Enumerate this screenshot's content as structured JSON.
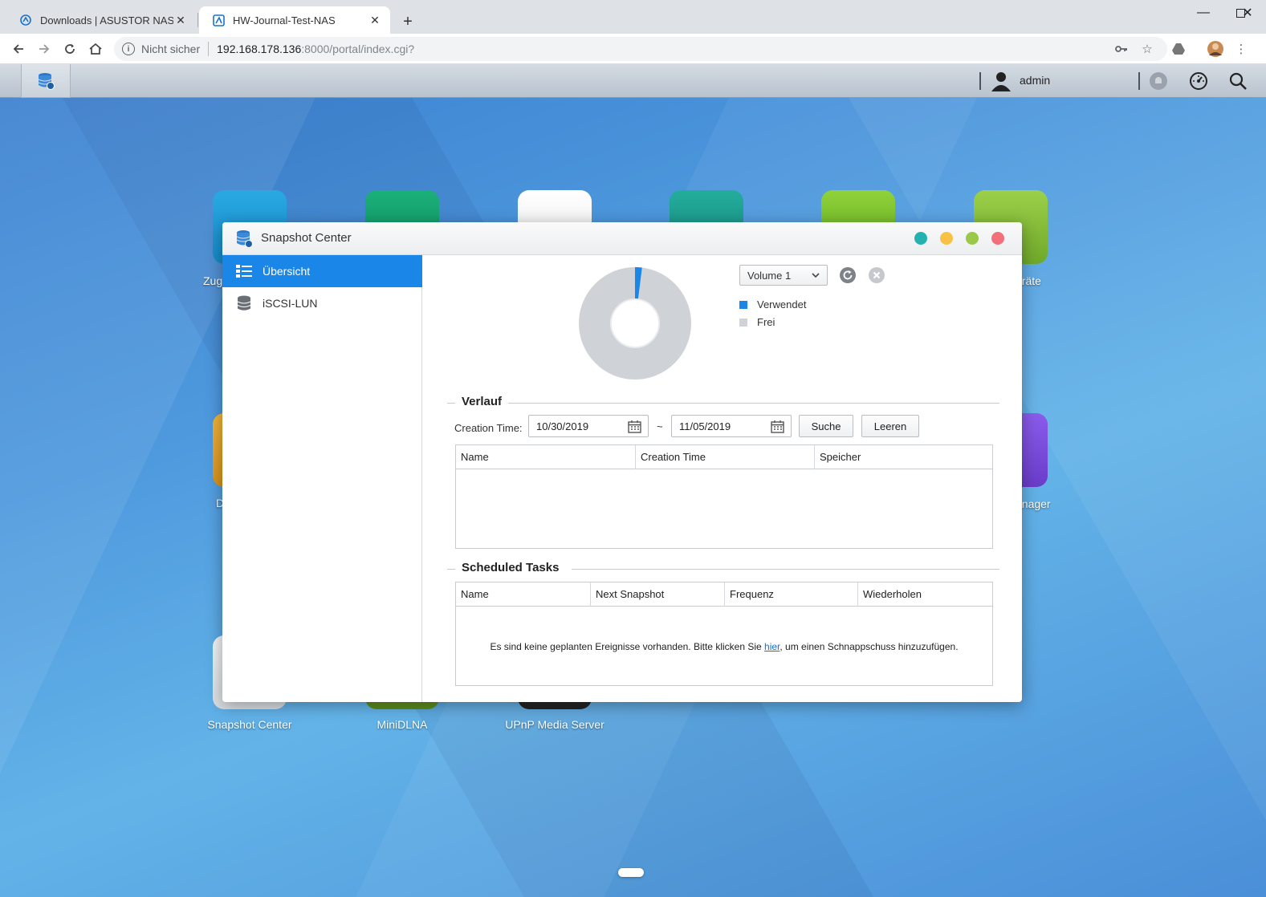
{
  "browser": {
    "tabs": [
      {
        "title": "Downloads | ASUSTOR NAS",
        "active": false
      },
      {
        "title": "HW-Journal-Test-NAS",
        "active": true
      }
    ],
    "security_label": "Nicht sicher",
    "url_host": "192.168.178.136",
    "url_path": ":8000/portal/index.cgi?"
  },
  "taskbar": {
    "user": "admin"
  },
  "desktop_icons": [
    {
      "label": "Zug",
      "color": "#1b9ad6"
    },
    {
      "label": "",
      "color": "#16a06f"
    },
    {
      "label": "",
      "color": "#f3f3f3"
    },
    {
      "label": "",
      "color": "#1a9a8a"
    },
    {
      "label": "",
      "color": "#7cc62e"
    },
    {
      "label": "eräte",
      "color": "#8cc63e"
    },
    {
      "label": "D",
      "color": "#e8a42a"
    },
    {
      "label": "anager",
      "color": "#7b4dd8"
    },
    {
      "label": "Snapshot Center",
      "color": "#e7e9ec"
    },
    {
      "label": "MiniDLNA",
      "color": "#6aa123"
    },
    {
      "label": "UPnP Media Server",
      "color": "#333333"
    }
  ],
  "window": {
    "title": "Snapshot Center",
    "controls": {
      "colors": [
        "#26b1b1",
        "#f6c145",
        "#9ac848",
        "#f1707a"
      ]
    }
  },
  "sidebar": {
    "items": [
      {
        "label": "Übersicht",
        "icon": "list-icon",
        "active": true
      },
      {
        "label": "iSCSI-LUN",
        "icon": "database-icon",
        "active": false
      }
    ]
  },
  "overview": {
    "volume_select": "Volume 1",
    "legend": [
      {
        "label": "Verwendet",
        "color": "#1a87e8"
      },
      {
        "label": "Frei",
        "color": "#cfd2d6"
      }
    ],
    "usage": {
      "used_fraction": 0.02
    }
  },
  "history": {
    "title": "Verlauf",
    "filter_label": "Creation Time:",
    "from_date": "10/30/2019",
    "separator": "~",
    "to_date": "11/05/2019",
    "search_button": "Suche",
    "clear_button": "Leeren",
    "columns": [
      "Name",
      "Creation Time",
      "Speicher"
    ]
  },
  "scheduled": {
    "title": "Scheduled Tasks",
    "columns": [
      "Name",
      "Next Snapshot",
      "Frequenz",
      "Wiederholen"
    ],
    "empty_prefix": "Es sind keine geplanten Ereignisse vorhanden. Bitte klicken Sie ",
    "empty_link": "hier",
    "empty_suffix": ", um einen Schnappschuss hinzuzufügen."
  }
}
